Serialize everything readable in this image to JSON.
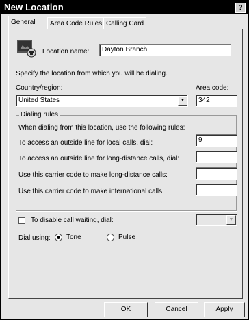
{
  "window": {
    "title": "New Location",
    "help_label": "?"
  },
  "tabs": [
    {
      "label": "General"
    },
    {
      "label": "Area Code Rules"
    },
    {
      "label": "Calling Card"
    }
  ],
  "general": {
    "location_name_label": "Location name:",
    "location_name_value": "Dayton Branch",
    "specify_text": "Specify the location from which you will be dialing.",
    "country_label": "Country/region:",
    "country_value": "United States",
    "area_code_label": "Area code:",
    "area_code_value": "342",
    "dialing_rules": {
      "legend": "Dialing rules",
      "intro": "When dialing from this location, use the following rules:",
      "local_label": "To access an outside line for local calls, dial:",
      "local_value": "9",
      "long_distance_label": "To access an outside line for long-distance calls, dial:",
      "long_distance_value": "",
      "carrier_long_label": "Use this carrier code to make long-distance calls:",
      "carrier_long_value": "",
      "carrier_intl_label": "Use this carrier code to make international calls:",
      "carrier_intl_value": ""
    },
    "call_waiting": {
      "label": "To disable call waiting, dial:",
      "checked": false,
      "value": ""
    },
    "dial_using": {
      "label": "Dial using:",
      "options": [
        "Tone",
        "Pulse"
      ],
      "selected": "Tone"
    }
  },
  "buttons": {
    "ok": "OK",
    "cancel": "Cancel",
    "apply": "Apply"
  },
  "icons": {
    "location": "location-phone-icon",
    "dropdown": "chevron-down-icon",
    "help": "help-icon"
  }
}
